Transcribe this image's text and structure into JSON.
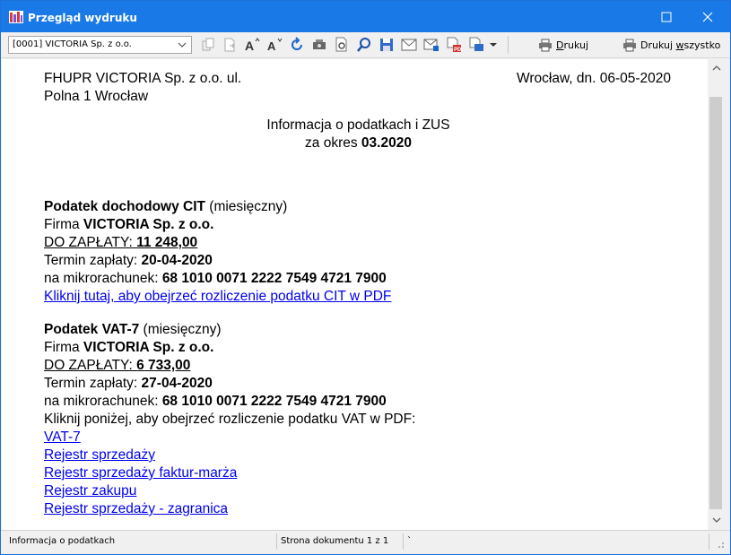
{
  "window": {
    "title": "Przegląd wydruku"
  },
  "toolbar": {
    "document_select_value": "[0001] VICTORIA Sp. z o.o.",
    "print_label_u": "D",
    "print_label_rest": "rukuj",
    "print_all_label_pre": "Drukuj ",
    "print_all_label_u": "w",
    "print_all_label_rest": "szystko",
    "icons": [
      "copy-icon",
      "export-icon",
      "font-increase-icon",
      "font-decrease-icon",
      "refresh-icon",
      "settings-icon",
      "settings-alt-icon",
      "search-icon",
      "save-icon",
      "email-icon",
      "email-attachment-icon",
      "pdf-icon",
      "export-dropdown-icon"
    ]
  },
  "document": {
    "company_line1": "FHUPR VICTORIA Sp. z o.o. ul.",
    "company_line2": "Polna 1 Wrocław",
    "place_date": "Wrocław, dn. 06-05-2020",
    "heading_line1": "Informacja o podatkach i ZUS",
    "heading_period_prefix": "za okres ",
    "heading_period": "03.2020",
    "cit": {
      "title": "Podatek dochodowy CIT",
      "title_suffix": " (miesięczny)",
      "firm_prefix": "Firma ",
      "firm": "VICTORIA Sp. z o.o.",
      "due_prefix": "DO ZAPŁATY: ",
      "due_amount": "11 248,00",
      "deadline_prefix": "Termin zapłaty: ",
      "deadline": "20-04-2020",
      "account_prefix": "na mikrorachunek: ",
      "account": "68 1010 0071 2222 7549 4721 7900",
      "pdf_link": "Kliknij tutaj, aby obejrzeć rozliczenie podatku CIT w PDF"
    },
    "vat": {
      "title": "Podatek VAT-7",
      "title_suffix": " (miesięczny)",
      "firm_prefix": "Firma ",
      "firm": "VICTORIA Sp. z o.o.",
      "due_prefix": "DO ZAPŁATY: ",
      "due_amount": "6 733,00",
      "deadline_prefix": "Termin zapłaty: ",
      "deadline": "27-04-2020",
      "account_prefix": "na mikrorachunek: ",
      "account": "68 1010 0071 2222 7549 4721 7900",
      "pdf_intro": "Kliknij poniżej, aby obejrzeć rozliczenie podatku VAT w PDF:",
      "links": [
        "VAT-7",
        "Rejestr sprzedaży",
        "Rejestr sprzedaży faktur-marża",
        "Rejestr zakupu",
        "Rejestr sprzedaży - zagranica"
      ]
    }
  },
  "statusbar": {
    "left": "Informacja o podatkach",
    "middle": "Strona dokumentu 1 z 1",
    "right": "`"
  },
  "colors": {
    "titlebar": "#1979e6",
    "link": "#0000ee"
  }
}
